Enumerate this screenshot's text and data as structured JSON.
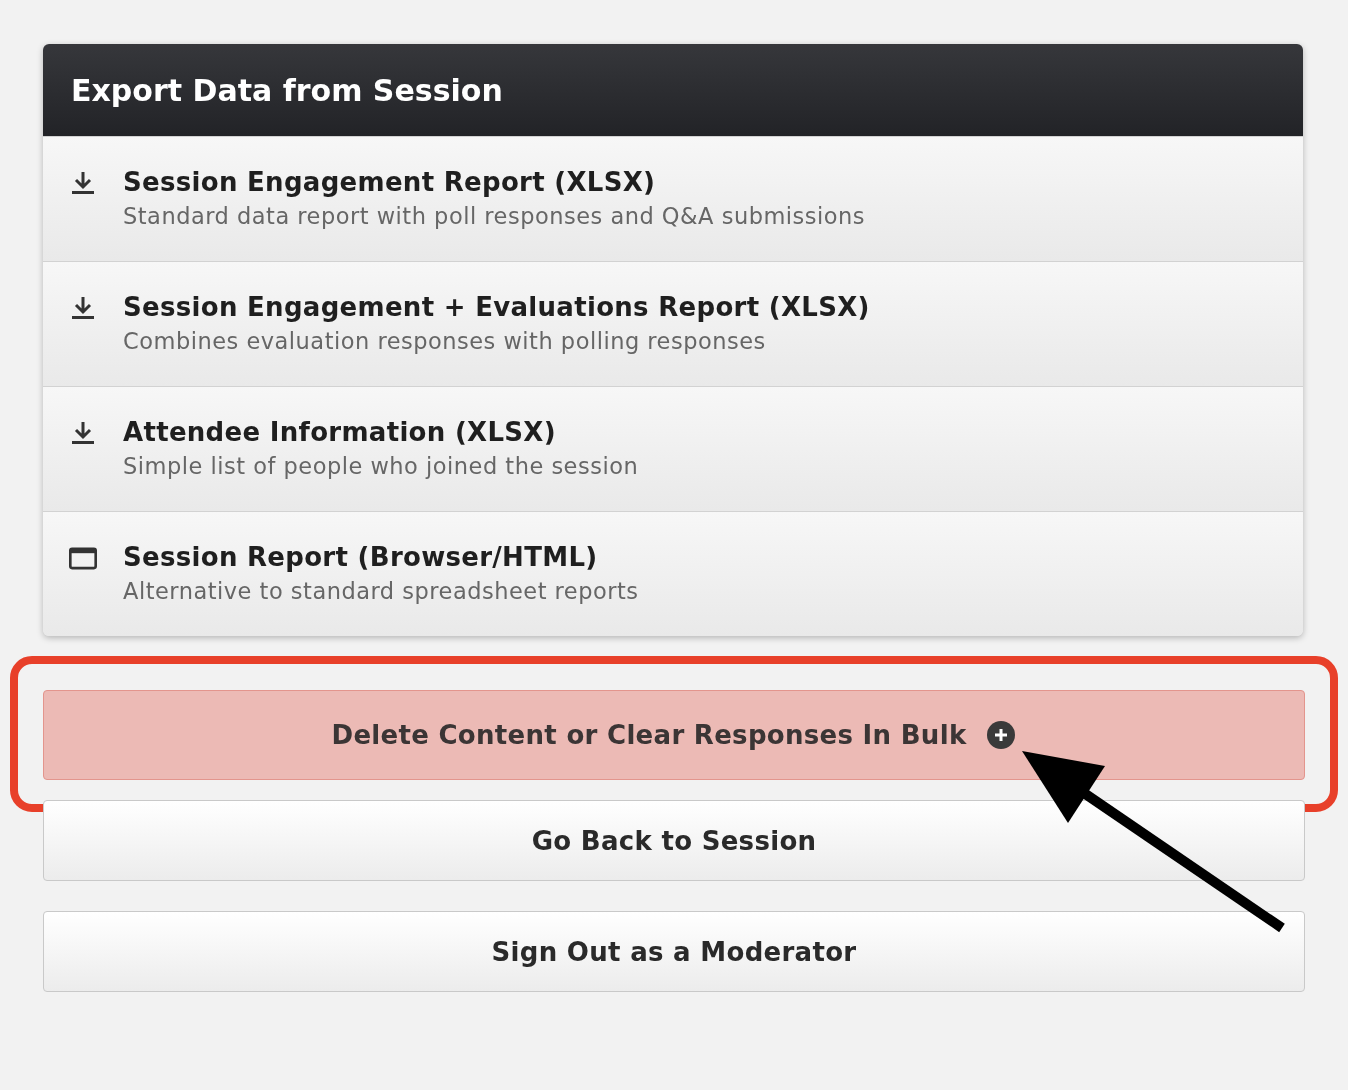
{
  "panel": {
    "title": "Export Data from Session",
    "items": [
      {
        "kind": "download",
        "title": "Session Engagement Report (XLSX)",
        "subtitle": "Standard data report with poll responses and Q&A submissions"
      },
      {
        "kind": "download",
        "title": "Session Engagement + Evaluations Report (XLSX)",
        "subtitle": "Combines evaluation responses with polling responses"
      },
      {
        "kind": "download",
        "title": "Attendee Information (XLSX)",
        "subtitle": "Simple list of people who joined the session"
      },
      {
        "kind": "browser",
        "title": "Session Report (Browser/HTML)",
        "subtitle": "Alternative to standard spreadsheet reports"
      }
    ]
  },
  "buttons": [
    {
      "kind": "danger",
      "label": "Delete Content or Clear Responses In Bulk",
      "highlighted": true
    },
    {
      "kind": "default",
      "label": "Go Back to Session",
      "highlighted": false
    },
    {
      "kind": "default",
      "label": "Sign Out as a Moderator",
      "highlighted": false
    }
  ]
}
